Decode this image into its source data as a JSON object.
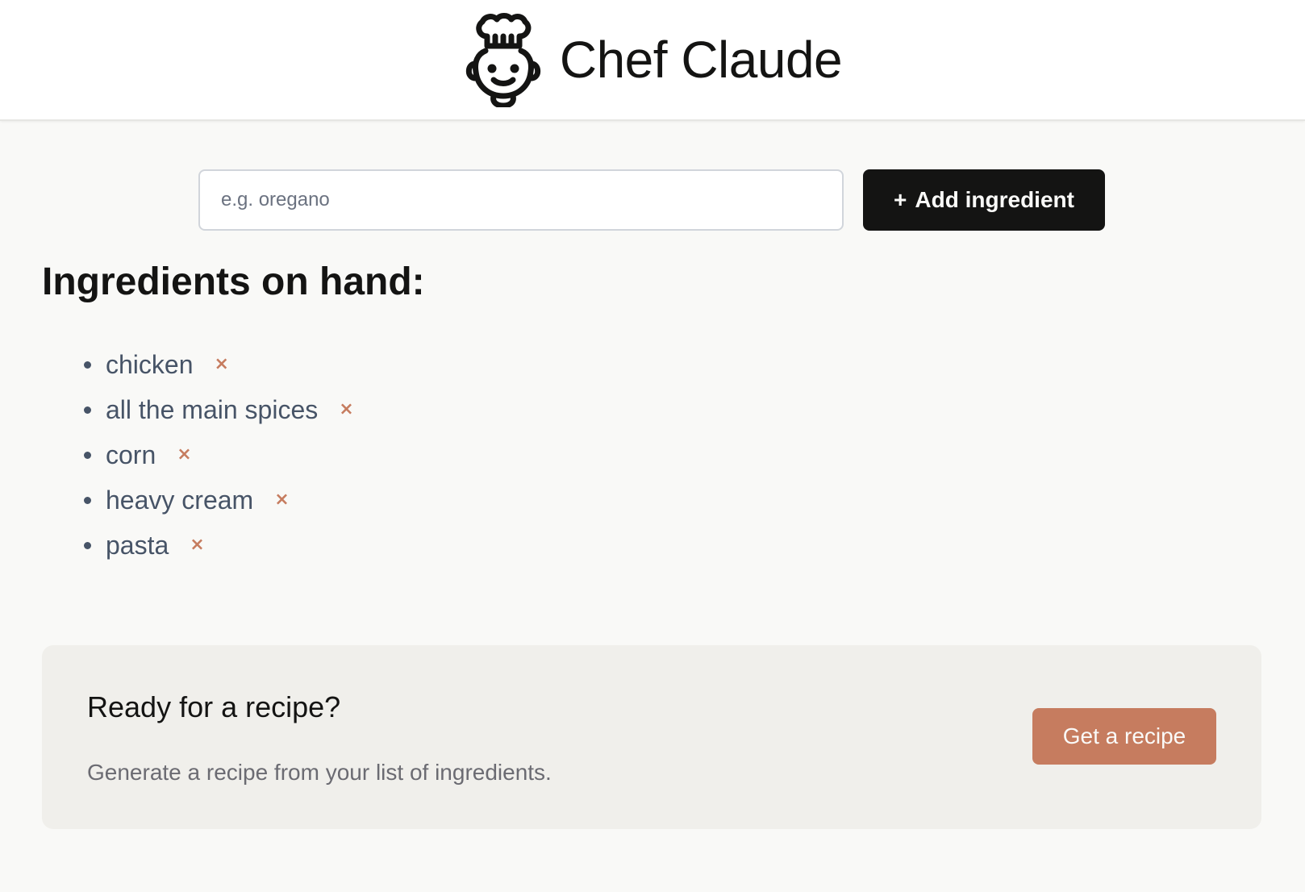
{
  "header": {
    "title": "Chef Claude",
    "logo_icon": "chef-hat-face-icon"
  },
  "form": {
    "input_placeholder": "e.g. oregano",
    "input_value": "",
    "add_button_plus": "+",
    "add_button_label": "Add ingredient"
  },
  "ingredients": {
    "heading": "Ingredients on hand:",
    "remove_glyph": "×",
    "items": [
      {
        "label": "chicken"
      },
      {
        "label": "all the main spices"
      },
      {
        "label": "corn"
      },
      {
        "label": "heavy cream"
      },
      {
        "label": "pasta"
      }
    ]
  },
  "recipe_cta": {
    "title": "Ready for a recipe?",
    "description": "Generate a recipe from your list of ingredients.",
    "button_label": "Get a recipe"
  },
  "colors": {
    "accent": "#c67c5f",
    "dark_button": "#141413",
    "page_bg": "#f9f9f7",
    "panel_bg": "#f0efeb",
    "list_text": "#475467"
  }
}
